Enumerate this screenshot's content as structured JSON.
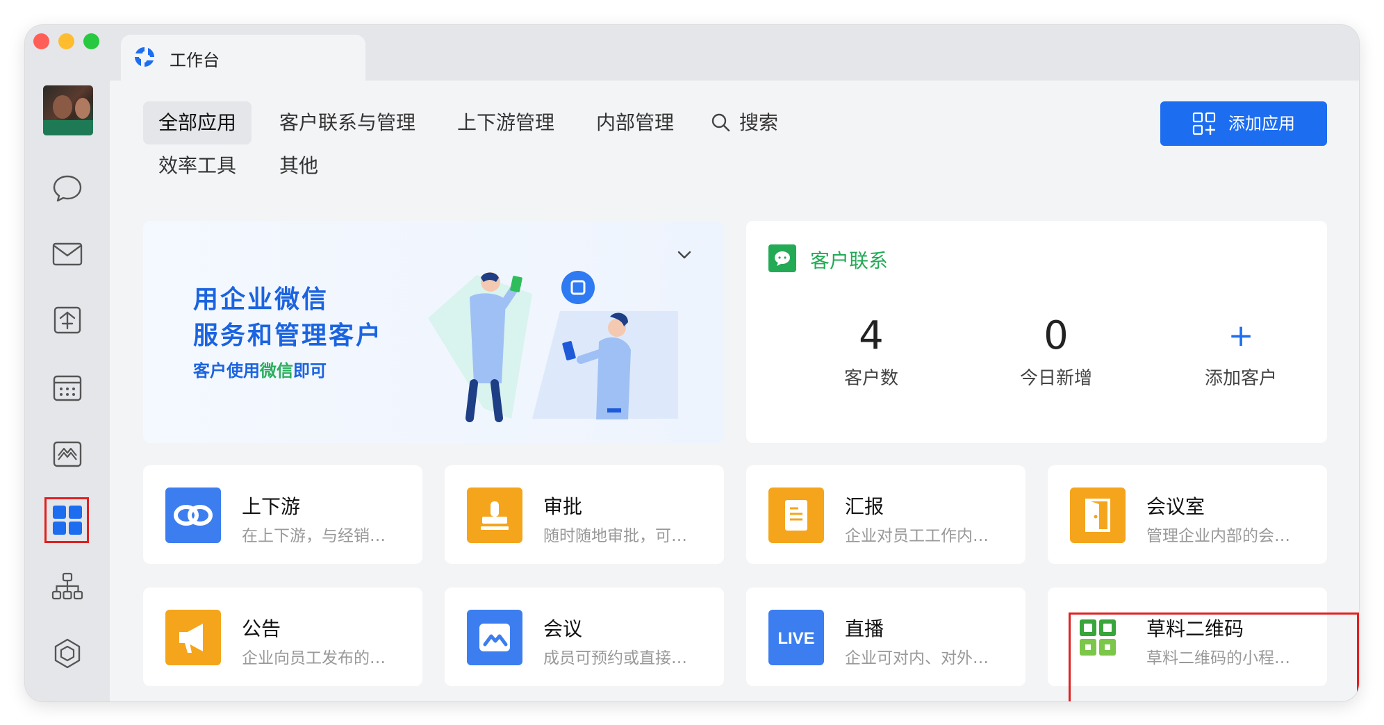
{
  "tab": {
    "title": "工作台"
  },
  "categories": {
    "row1": [
      {
        "label": "全部应用",
        "active": true
      },
      {
        "label": "客户联系与管理",
        "active": false
      },
      {
        "label": "上下游管理",
        "active": false
      },
      {
        "label": "内部管理",
        "active": false
      }
    ],
    "search_label": "搜索",
    "row2": [
      {
        "label": "效率工具",
        "active": false
      },
      {
        "label": "其他",
        "active": false
      }
    ]
  },
  "add_app": {
    "label": "添加应用"
  },
  "banner": {
    "title_line1": "用企业微信",
    "title_line2": "服务和管理客户",
    "subtitle_a": "客户使用",
    "subtitle_b": "微信",
    "subtitle_c": "即可"
  },
  "customer": {
    "title": "客户联系",
    "stats": [
      {
        "value": "4",
        "label": "客户数"
      },
      {
        "value": "0",
        "label": "今日新增"
      },
      {
        "value": "+",
        "label": "添加客户"
      }
    ]
  },
  "apps": [
    {
      "name": "上下游",
      "desc": "在上下游，与经销…",
      "icon": "link-icon",
      "color": "#3c7ef0"
    },
    {
      "name": "审批",
      "desc": "随时随地审批，可…",
      "icon": "stamp-icon",
      "color": "#f4a51c"
    },
    {
      "name": "汇报",
      "desc": "企业对员工工作内…",
      "icon": "report-icon",
      "color": "#f4a51c"
    },
    {
      "name": "会议室",
      "desc": "管理企业内部的会…",
      "icon": "door-icon",
      "color": "#f4a51c"
    },
    {
      "name": "公告",
      "desc": "企业向员工发布的…",
      "icon": "megaphone-icon",
      "color": "#f4a51c"
    },
    {
      "name": "会议",
      "desc": "成员可预约或直接…",
      "icon": "meeting-icon",
      "color": "#3c7ef0"
    },
    {
      "name": "直播",
      "desc": "企业可对内、对外…",
      "icon": "live-icon",
      "icon_text": "LIVE",
      "color": "#3c7ef0"
    },
    {
      "name": "草料二维码",
      "desc": "草料二维码的小程…",
      "icon": "qrcode-icon",
      "color": "#39a53a"
    }
  ],
  "colors": {
    "accent": "#1c6df0",
    "customer_green": "#22aa55",
    "highlight_red": "#e02020"
  }
}
